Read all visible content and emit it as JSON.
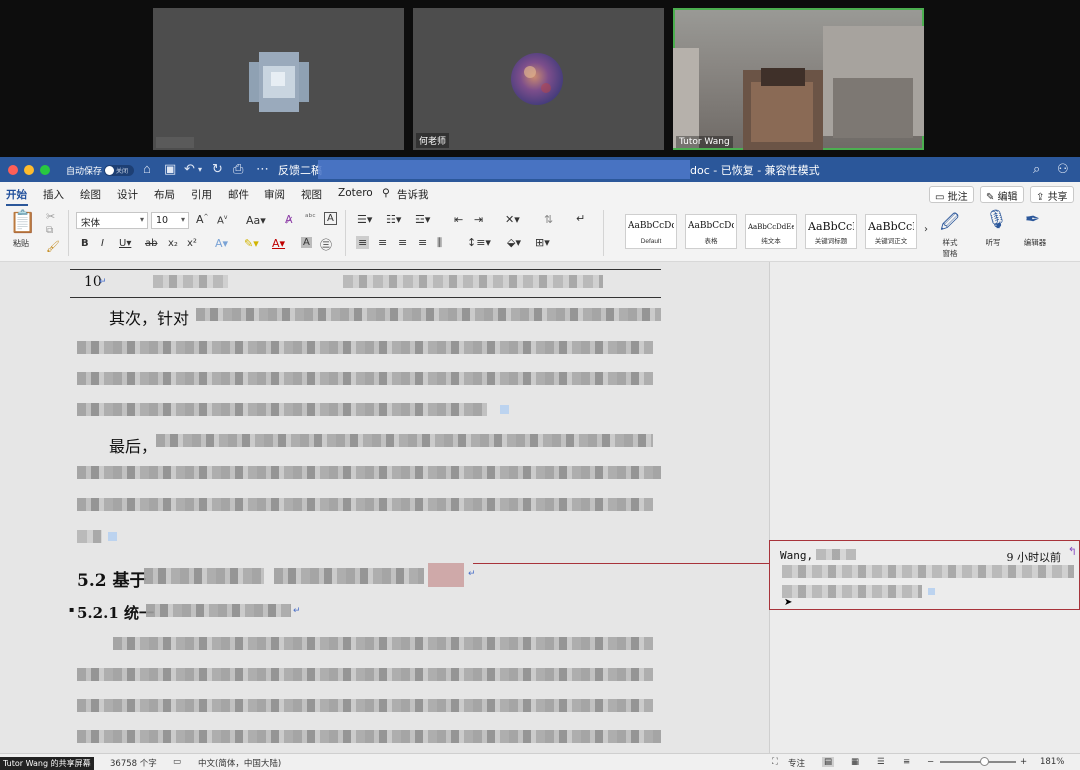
{
  "video": {
    "participants": [
      {
        "name": ""
      },
      {
        "name": "何老师"
      },
      {
        "name": "Tutor Wang"
      }
    ]
  },
  "titlebar": {
    "autosave": "自动保存",
    "autosave_state": "关闭",
    "doc_title_left": "反馈二稿",
    "doc_title_right": "doc - 已恢复 - 兼容性模式"
  },
  "ribbon": {
    "tabs": [
      "开始",
      "插入",
      "绘图",
      "设计",
      "布局",
      "引用",
      "邮件",
      "审阅",
      "视图",
      "Zotero",
      "告诉我"
    ],
    "comments_btn": "批注",
    "edit_btn": "编辑",
    "share_btn": "共享",
    "paste": "粘贴",
    "font_name": "宋体",
    "font_size": "10",
    "styles": [
      {
        "sample": "AaBbCcDdE",
        "name": "Default"
      },
      {
        "sample": "AaBbCcDdEe",
        "name": "表格"
      },
      {
        "sample": "AaBbCcDdEe",
        "name": "纯文本"
      },
      {
        "sample": "AaBbCcDd",
        "name": "关键词标题"
      },
      {
        "sample": "AaBbCcDd",
        "name": "关键词正文"
      }
    ],
    "style_pane": "样式\n窗格",
    "dictate": "听写",
    "editor": "编辑器"
  },
  "document": {
    "table_num": "10",
    "p1_start": "其次，针对",
    "p2_start": "最后，",
    "heading_52": "5.2 基于",
    "heading_521": "5.2.1 统一"
  },
  "comment": {
    "author": "Wang,",
    "time": "9 小时以前"
  },
  "status": {
    "share_label": "Tutor Wang 的共享屏幕",
    "word_count": "36758 个字",
    "language": "中文(简体，中国大陆)",
    "focus": "专注",
    "zoom": "181%"
  },
  "colors": {
    "titlebar": "#2b579a",
    "comment_border": "#a8333a",
    "active_speaker": "#4caf50"
  }
}
